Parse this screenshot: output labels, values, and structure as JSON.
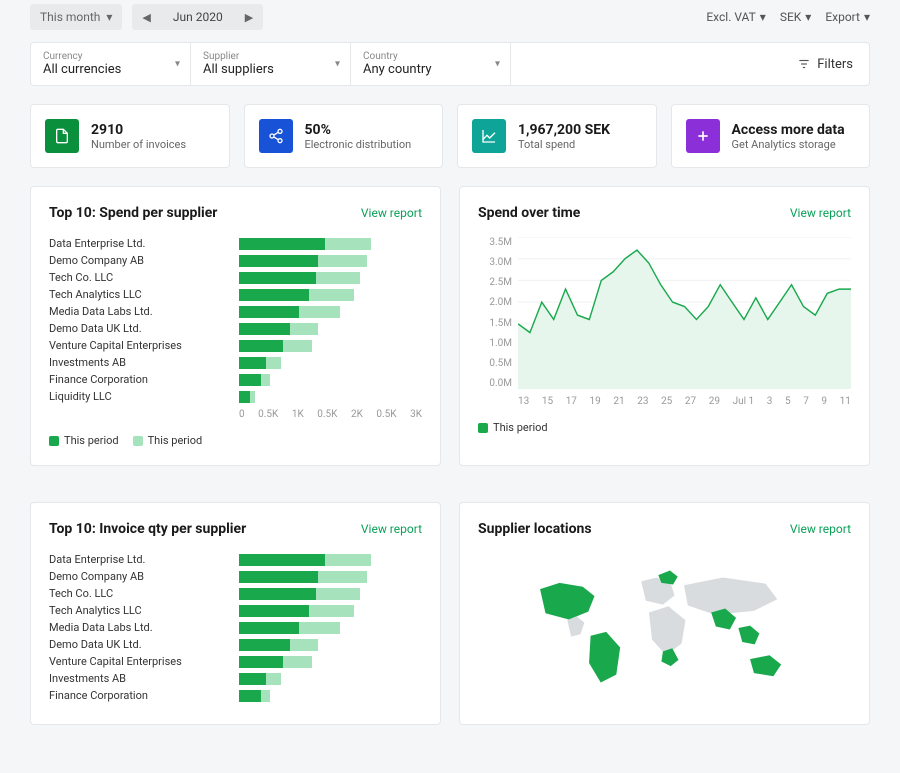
{
  "topbar": {
    "period_selector": "This month",
    "date_label": "Jun 2020",
    "vat": "Excl. VAT",
    "currency": "SEK",
    "export": "Export"
  },
  "filters": {
    "currency": {
      "label": "Currency",
      "value": "All currencies"
    },
    "supplier": {
      "label": "Supplier",
      "value": "All suppliers"
    },
    "country": {
      "label": "Country",
      "value": "Any country"
    },
    "filters_btn": "Filters"
  },
  "cards": {
    "invoices": {
      "value": "2910",
      "label": "Number of invoices"
    },
    "distribution": {
      "value": "50%",
      "label": "Electronic distribution"
    },
    "spend": {
      "value": "1,967,200 SEK",
      "label": "Total spend"
    },
    "access": {
      "value": "Access more data",
      "label": "Get Analytics storage"
    }
  },
  "view_report": "View report",
  "legend": {
    "a": "This period",
    "b": "This period"
  },
  "spend_supplier": {
    "title": "Top 10: Spend per supplier",
    "axis": [
      "0",
      "0.5K",
      "1K",
      "0.5K",
      "2K",
      "0.5K",
      "3K"
    ],
    "rows": [
      {
        "name": "Data Enterprise Ltd.",
        "a": 47,
        "b": 25
      },
      {
        "name": "Demo Company AB",
        "a": 43,
        "b": 27
      },
      {
        "name": "Tech Co. LLC",
        "a": 42,
        "b": 24
      },
      {
        "name": "Tech Analytics LLC",
        "a": 38,
        "b": 25
      },
      {
        "name": "Media Data Labs Ltd.",
        "a": 33,
        "b": 22
      },
      {
        "name": "Demo Data UK Ltd.",
        "a": 28,
        "b": 15
      },
      {
        "name": "Venture Capital Enterprises",
        "a": 24,
        "b": 16
      },
      {
        "name": "Investments AB",
        "a": 15,
        "b": 8
      },
      {
        "name": "Finance Corporation",
        "a": 12,
        "b": 5
      },
      {
        "name": "Liquidity LLC",
        "a": 6,
        "b": 3
      }
    ]
  },
  "invoice_qty": {
    "title": "Top 10: Invoice qty per supplier",
    "rows": [
      {
        "name": "Data Enterprise Ltd.",
        "a": 47,
        "b": 25
      },
      {
        "name": "Demo Company AB",
        "a": 43,
        "b": 27
      },
      {
        "name": "Tech Co. LLC",
        "a": 42,
        "b": 24
      },
      {
        "name": "Tech Analytics LLC",
        "a": 38,
        "b": 25
      },
      {
        "name": "Media Data Labs Ltd.",
        "a": 33,
        "b": 22
      },
      {
        "name": "Demo Data UK Ltd.",
        "a": 28,
        "b": 15
      },
      {
        "name": "Venture Capital Enterprises",
        "a": 24,
        "b": 16
      },
      {
        "name": "Investments AB",
        "a": 15,
        "b": 8
      },
      {
        "name": "Finance Corporation",
        "a": 12,
        "b": 5
      }
    ]
  },
  "spend_time": {
    "title": "Spend over time",
    "ylabels": [
      "3.5M",
      "3.0M",
      "2.5M",
      "2.0M",
      "1.5M",
      "1.0M",
      "0.5M",
      "0.0M"
    ],
    "xlabels": [
      "13",
      "15",
      "17",
      "19",
      "21",
      "23",
      "25",
      "27",
      "29",
      "Jul 1",
      "3",
      "5",
      "7",
      "9",
      "11"
    ]
  },
  "supplier_locations": {
    "title": "Supplier locations"
  },
  "chart_data": {
    "spend_per_supplier": {
      "type": "bar",
      "orientation": "horizontal",
      "title": "Top 10: Spend per supplier",
      "categories": [
        "Data Enterprise Ltd.",
        "Demo Company AB",
        "Tech Co. LLC",
        "Tech Analytics LLC",
        "Media Data Labs Ltd.",
        "Demo Data UK Ltd.",
        "Venture Capital Enterprises",
        "Investments AB",
        "Finance Corporation",
        "Liquidity LLC"
      ],
      "series": [
        {
          "name": "This period",
          "values": [
            1400,
            1300,
            1250,
            1150,
            1000,
            850,
            720,
            450,
            360,
            180
          ]
        },
        {
          "name": "This period",
          "values": [
            750,
            810,
            720,
            750,
            660,
            450,
            480,
            240,
            150,
            90
          ]
        }
      ],
      "xlim": [
        0,
        3000
      ],
      "xlabel": "",
      "ylabel": ""
    },
    "spend_over_time": {
      "type": "area",
      "title": "Spend over time",
      "x": [
        "13",
        "14",
        "15",
        "16",
        "17",
        "18",
        "19",
        "20",
        "21",
        "22",
        "23",
        "24",
        "25",
        "26",
        "27",
        "28",
        "29",
        "30",
        "Jul 1",
        "2",
        "3",
        "4",
        "5",
        "6",
        "7",
        "8",
        "9",
        "10",
        "11"
      ],
      "series": [
        {
          "name": "This period",
          "values": [
            1.5,
            1.3,
            2.0,
            1.6,
            2.3,
            1.7,
            1.6,
            2.5,
            2.7,
            3.0,
            3.2,
            2.9,
            2.4,
            2.0,
            1.9,
            1.6,
            1.9,
            2.4,
            2.0,
            1.6,
            2.1,
            1.6,
            2.0,
            2.4,
            1.9,
            1.7,
            2.2,
            2.3,
            2.3
          ]
        }
      ],
      "ylim": [
        0,
        3.5
      ],
      "ylabel": "M"
    },
    "invoice_qty_per_supplier": {
      "type": "bar",
      "orientation": "horizontal",
      "title": "Top 10: Invoice qty per supplier",
      "categories": [
        "Data Enterprise Ltd.",
        "Demo Company AB",
        "Tech Co. LLC",
        "Tech Analytics LLC",
        "Media Data Labs Ltd.",
        "Demo Data UK Ltd.",
        "Venture Capital Enterprises",
        "Investments AB",
        "Finance Corporation"
      ],
      "series": [
        {
          "name": "This period",
          "values": [
            47,
            43,
            42,
            38,
            33,
            28,
            24,
            15,
            12
          ]
        },
        {
          "name": "This period",
          "values": [
            25,
            27,
            24,
            25,
            22,
            15,
            16,
            8,
            5
          ]
        }
      ]
    },
    "supplier_locations": {
      "type": "map",
      "title": "Supplier locations",
      "active_regions": [
        "North America",
        "South America",
        "Northern Europe",
        "Southern Africa",
        "South Asia",
        "Southeast Asia",
        "Australia"
      ]
    }
  }
}
